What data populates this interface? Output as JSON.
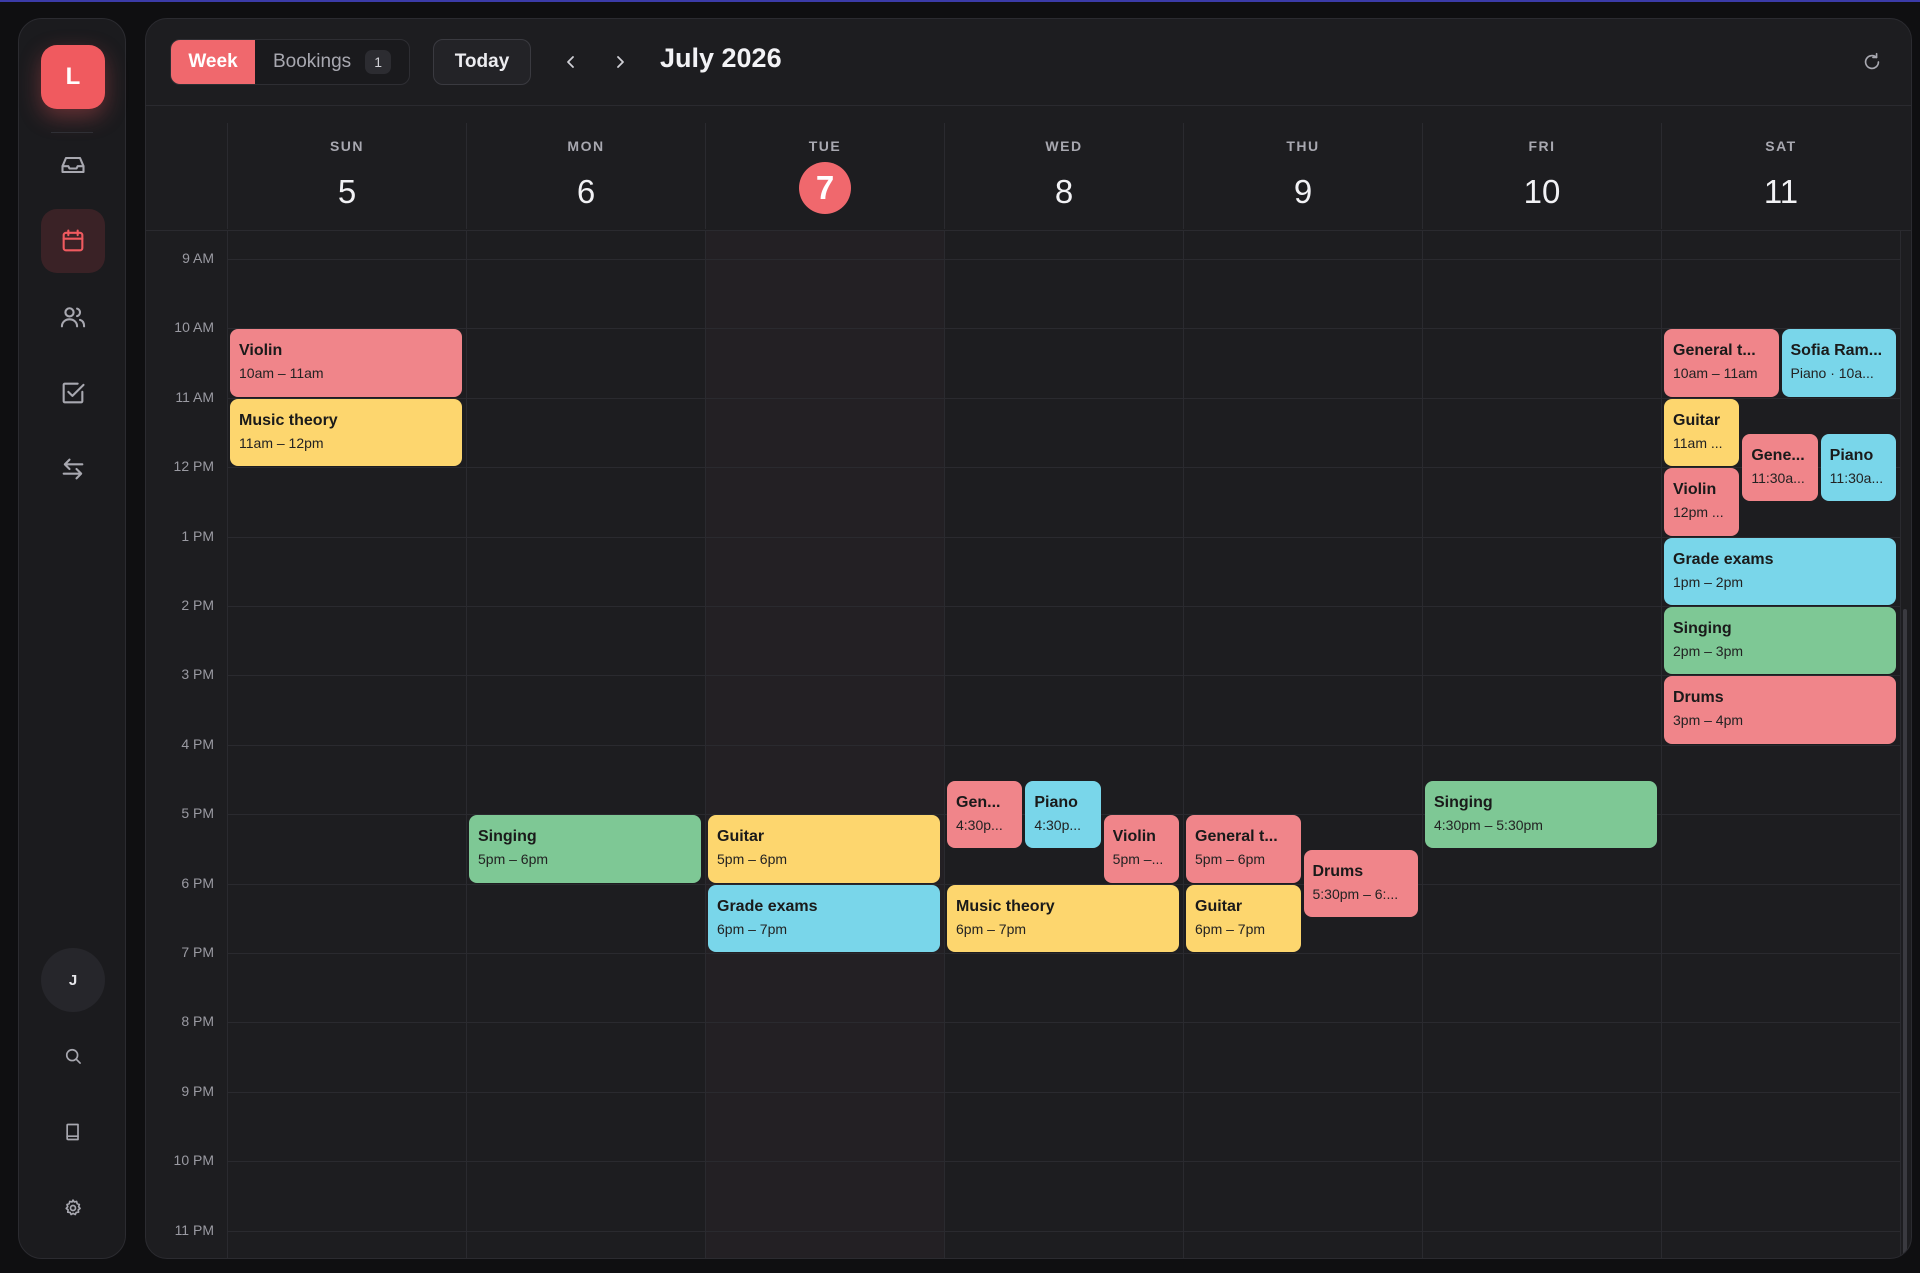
{
  "sidebar": {
    "logo_letter": "L",
    "user_initial": "J",
    "items": [
      {
        "icon": "inbox-icon",
        "active": false
      },
      {
        "icon": "calendar-icon",
        "active": true
      },
      {
        "icon": "users-icon",
        "active": false
      },
      {
        "icon": "checkbox-icon",
        "active": false
      },
      {
        "icon": "transfer-icon",
        "active": false
      }
    ],
    "bottom_items": [
      "search-icon",
      "book-icon",
      "gear-icon"
    ]
  },
  "toolbar": {
    "view_week_label": "Week",
    "view_bookings_label": "Bookings",
    "bookings_count": "1",
    "today_label": "Today",
    "prev_icon": "chevron-left-icon",
    "next_icon": "chevron-right-icon",
    "month_title": "July 2026",
    "refresh_icon": "refresh-icon"
  },
  "days": [
    {
      "name": "SUN",
      "num": "5"
    },
    {
      "name": "MON",
      "num": "6"
    },
    {
      "name": "TUE",
      "num": "7",
      "today": true
    },
    {
      "name": "WED",
      "num": "8"
    },
    {
      "name": "THU",
      "num": "9"
    },
    {
      "name": "FRI",
      "num": "10"
    },
    {
      "name": "SAT",
      "num": "11"
    }
  ],
  "hours": [
    "9 AM",
    "10 AM",
    "11 AM",
    "12 PM",
    "1 PM",
    "2 PM",
    "3 PM",
    "4 PM",
    "5 PM",
    "6 PM",
    "7 PM",
    "8 PM",
    "9 PM",
    "10 PM",
    "11 PM"
  ],
  "colors": {
    "red": "#f0858a",
    "yellow": "#fdd66e",
    "blue": "#79d6ea",
    "green": "#7ec895",
    "accent": "#f0686d"
  },
  "events": [
    {
      "day": 0,
      "start": 10,
      "end": 11,
      "title": "Violin",
      "sub": "10am – 11am",
      "color": "red"
    },
    {
      "day": 0,
      "start": 11,
      "end": 12,
      "title": "Music theory",
      "sub": "11am – 12pm",
      "color": "yellow"
    },
    {
      "day": 1,
      "start": 17,
      "end": 18,
      "title": "Singing",
      "sub": "5pm – 6pm",
      "color": "green"
    },
    {
      "day": 2,
      "start": 17,
      "end": 18,
      "title": "Guitar",
      "sub": "5pm – 6pm",
      "color": "yellow"
    },
    {
      "day": 2,
      "start": 18,
      "end": 19,
      "title": "Grade exams",
      "sub": "6pm – 7pm",
      "color": "blue"
    },
    {
      "day": 3,
      "start": 16.5,
      "end": 17.5,
      "title": "Gen...",
      "sub": "4:30p...",
      "color": "red",
      "col": 0,
      "cols": 3
    },
    {
      "day": 3,
      "start": 16.5,
      "end": 17.5,
      "title": "Piano",
      "sub": "4:30p...",
      "color": "blue",
      "col": 1,
      "cols": 3
    },
    {
      "day": 3,
      "start": 17,
      "end": 18,
      "title": "Violin",
      "sub": "5pm –...",
      "color": "red",
      "col": 2,
      "cols": 3
    },
    {
      "day": 3,
      "start": 18,
      "end": 19,
      "title": "Music theory",
      "sub": "6pm – 7pm",
      "color": "yellow"
    },
    {
      "day": 4,
      "start": 17,
      "end": 18,
      "title": "General t...",
      "sub": "5pm – 6pm",
      "color": "red",
      "col": 0,
      "cols": 2
    },
    {
      "day": 4,
      "start": 18,
      "end": 19,
      "title": "Guitar",
      "sub": "6pm – 7pm",
      "color": "yellow",
      "col": 0,
      "cols": 2
    },
    {
      "day": 4,
      "start": 17.5,
      "end": 18.5,
      "title": "Drums",
      "sub": "5:30pm – 6:...",
      "color": "red",
      "col": 1,
      "cols": 2
    },
    {
      "day": 5,
      "start": 16.5,
      "end": 17.5,
      "title": "Singing",
      "sub": "4:30pm – 5:30pm",
      "color": "green"
    },
    {
      "day": 6,
      "start": 10,
      "end": 11,
      "title": "General t...",
      "sub": "10am – 11am",
      "color": "red",
      "col": 0,
      "cols": 2
    },
    {
      "day": 6,
      "start": 10,
      "end": 11,
      "title": "Sofia Ram...",
      "sub": "Piano · 10a...",
      "color": "blue",
      "col": 1,
      "cols": 2
    },
    {
      "day": 6,
      "start": 11,
      "end": 12,
      "title": "Guitar",
      "sub": "11am ...",
      "color": "yellow",
      "col": 0,
      "cols": 3
    },
    {
      "day": 6,
      "start": 11.5,
      "end": 12.5,
      "title": "Gene...",
      "sub": "11:30a...",
      "color": "red",
      "col": 1,
      "cols": 3
    },
    {
      "day": 6,
      "start": 11.5,
      "end": 12.5,
      "title": "Piano",
      "sub": "11:30a...",
      "color": "blue",
      "col": 2,
      "cols": 3
    },
    {
      "day": 6,
      "start": 12,
      "end": 13,
      "title": "Violin",
      "sub": "12pm ...",
      "color": "red",
      "col": 0,
      "cols": 3
    },
    {
      "day": 6,
      "start": 13,
      "end": 14,
      "title": "Grade exams",
      "sub": "1pm – 2pm",
      "color": "blue"
    },
    {
      "day": 6,
      "start": 14,
      "end": 15,
      "title": "Singing",
      "sub": "2pm – 3pm",
      "color": "green"
    },
    {
      "day": 6,
      "start": 15,
      "end": 16,
      "title": "Drums",
      "sub": "3pm – 4pm",
      "color": "red"
    }
  ]
}
